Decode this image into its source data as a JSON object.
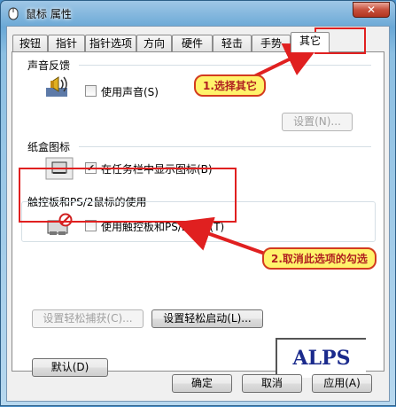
{
  "window": {
    "title": "鼠标 属性",
    "close_glyph": "✕"
  },
  "tabs": [
    {
      "label": "按钮"
    },
    {
      "label": "指针"
    },
    {
      "label": "指针选项"
    },
    {
      "label": "方向"
    },
    {
      "label": "硬件"
    },
    {
      "label": "轻击"
    },
    {
      "label": "手势"
    },
    {
      "label": "其它",
      "active": true
    }
  ],
  "sound": {
    "title": "声音反馈",
    "checkbox_label": "使用声音(S)",
    "checked": false,
    "settings_button": "设置(N)..."
  },
  "tray": {
    "title": "纸盒图标",
    "checkbox_label": "在任务栏中显示图标(B)",
    "checked": true
  },
  "touchpad": {
    "title": "触控板和PS/2鼠标的使用",
    "checkbox_label": "使用触控板和PS/2鼠标(T)",
    "checked": false
  },
  "annotations": {
    "step1": "1.选择其它",
    "step2": "2.取消此选项的勾选"
  },
  "buttons": {
    "ease_capture": "设置轻松捕获(C)...",
    "ease_launch": "设置轻松启动(L)...",
    "default": "默认(D)",
    "ok": "确定",
    "cancel": "取消",
    "apply": "应用(A)"
  },
  "logo": {
    "text": "ALPS"
  },
  "colors": {
    "annotation_red": "#e02020",
    "callout_bg": "#fff36b",
    "logo_blue": "#1a2a8c"
  }
}
